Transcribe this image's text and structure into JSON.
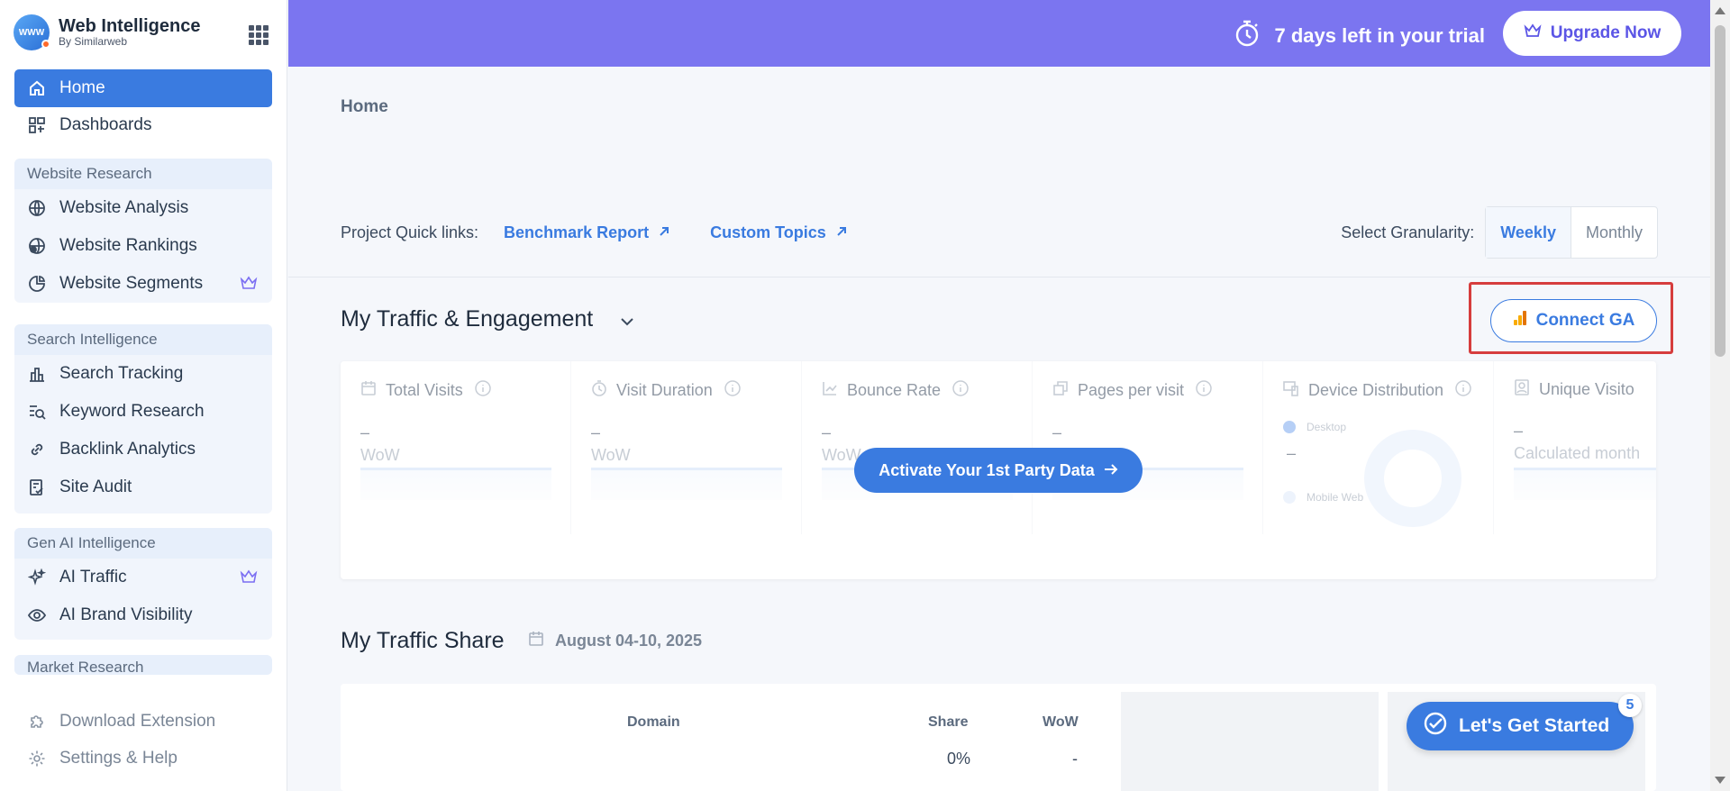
{
  "brand": {
    "title": "Web Intelligence",
    "subtitle": "By Similarweb",
    "logo_text": "WWW"
  },
  "sidebar": {
    "top_items": [
      {
        "label": "Home",
        "icon": "home-icon",
        "active": true
      },
      {
        "label": "Dashboards",
        "icon": "dashboard-icon",
        "active": false
      }
    ],
    "sections": [
      {
        "title": "Website Research",
        "items": [
          {
            "label": "Website Analysis",
            "icon": "globe-icon",
            "premium": false
          },
          {
            "label": "Website Rankings",
            "icon": "globe-rank-icon",
            "premium": false
          },
          {
            "label": "Website Segments",
            "icon": "pie-icon",
            "premium": true
          }
        ]
      },
      {
        "title": "Search Intelligence",
        "items": [
          {
            "label": "Search Tracking",
            "icon": "bar-chart-icon",
            "premium": false
          },
          {
            "label": "Keyword Research",
            "icon": "keyword-search-icon",
            "premium": false
          },
          {
            "label": "Backlink Analytics",
            "icon": "link-icon",
            "premium": false
          },
          {
            "label": "Site Audit",
            "icon": "audit-icon",
            "premium": false
          }
        ]
      },
      {
        "title": "Gen AI Intelligence",
        "items": [
          {
            "label": "AI Traffic",
            "icon": "sparkle-icon",
            "premium": true
          },
          {
            "label": "AI Brand Visibility",
            "icon": "eye-icon",
            "premium": false
          }
        ]
      },
      {
        "title": "Market Research",
        "items": []
      }
    ],
    "footer": [
      {
        "label": "Download Extension",
        "icon": "puzzle-icon"
      },
      {
        "label": "Settings & Help",
        "icon": "gear-icon"
      }
    ]
  },
  "topbar": {
    "trial_text": "7 days left in your trial",
    "upgrade_label": "Upgrade Now",
    "bg_color": "#7b75f0"
  },
  "main": {
    "breadcrumb": "Home",
    "quick_links_label": "Project Quick links:",
    "quick_links": [
      "Benchmark Report",
      "Custom Topics"
    ],
    "granularity_label": "Select Granularity:",
    "granularity_options": [
      "Weekly",
      "Monthly"
    ],
    "granularity_selected": "Weekly",
    "traffic_title": "My Traffic & Engagement",
    "connect_label": "Connect GA",
    "metrics": [
      {
        "label": "Total Visits",
        "icon": "calendar-icon",
        "value": "–",
        "sub": "WoW"
      },
      {
        "label": "Visit Duration",
        "icon": "timer-icon",
        "value": "–",
        "sub": "WoW"
      },
      {
        "label": "Bounce Rate",
        "icon": "trend-icon",
        "value": "–",
        "sub": "WoW"
      },
      {
        "label": "Pages per visit",
        "icon": "pages-icon",
        "value": "–",
        "sub": ""
      },
      {
        "label": "Device Distribution",
        "icon": "devices-icon",
        "value": "–",
        "sub": ""
      },
      {
        "label": "Unique Visito",
        "icon": "user-icon",
        "value": "–",
        "sub": "Calculated month"
      }
    ],
    "device_legend": [
      "Desktop",
      "Mobile Web"
    ],
    "activate_label": "Activate Your 1st Party Data",
    "share_title": "My Traffic Share",
    "share_date": "August 04-10, 2025",
    "share_table": {
      "headers": [
        "Domain",
        "Share",
        "WoW"
      ],
      "row": {
        "share": "0%",
        "wow": "-"
      }
    },
    "get_started_label": "Let's Get Started",
    "get_started_count": "5",
    "accent_color": "#3a7be0"
  }
}
